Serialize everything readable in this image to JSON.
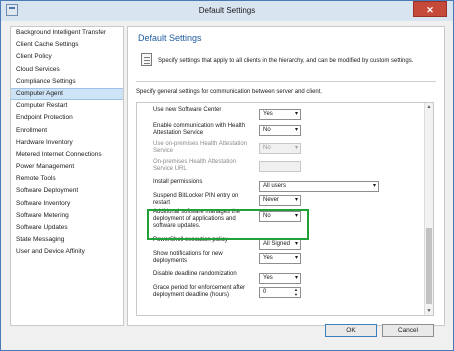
{
  "window": {
    "title": "Default Settings",
    "close_glyph": "✕"
  },
  "sidebar": {
    "items": [
      {
        "label": "Background Intelligent Transfer"
      },
      {
        "label": "Client Cache Settings"
      },
      {
        "label": "Client Policy"
      },
      {
        "label": "Cloud Services"
      },
      {
        "label": "Compliance Settings"
      },
      {
        "label": "Computer Agent",
        "selected": true
      },
      {
        "label": "Computer Restart"
      },
      {
        "label": "Endpoint Protection"
      },
      {
        "label": "Enrollment"
      },
      {
        "label": "Hardware Inventory"
      },
      {
        "label": "Metered Internet Connections"
      },
      {
        "label": "Power Management"
      },
      {
        "label": "Remote Tools"
      },
      {
        "label": "Software Deployment"
      },
      {
        "label": "Software Inventory"
      },
      {
        "label": "Software Metering"
      },
      {
        "label": "Software Updates"
      },
      {
        "label": "State Messaging"
      },
      {
        "label": "User and Device Affinity"
      }
    ]
  },
  "main": {
    "title": "Default Settings",
    "description": "Specify settings that apply to all clients in the hierarchy, and can be modified by custom settings.",
    "intro": "Specify general settings for communication between server and client."
  },
  "settings": [
    {
      "label": "Use new Software Center",
      "value": "Yes",
      "type": "select"
    },
    {
      "label": "Enable communication with Health Attestation Service",
      "value": "No",
      "type": "select"
    },
    {
      "label": "Use on-premises Health Attestation Service",
      "value": "No",
      "type": "select",
      "disabled": true
    },
    {
      "label": "On-premises Health Attestation Service URL",
      "value": "",
      "type": "text",
      "disabled": true
    },
    {
      "label": "Install permissions",
      "value": "All users",
      "type": "select"
    },
    {
      "label": "Suspend BitLocker PIN entry on restart",
      "value": "Never",
      "type": "select"
    },
    {
      "label": "Additional software manages the deployment of applications and software updates.",
      "value": "No",
      "type": "select"
    },
    {
      "label": "PowerShell execution policy",
      "value": "All Signed",
      "type": "select"
    },
    {
      "label": "Show notifications for new deployments",
      "value": "Yes",
      "type": "select"
    },
    {
      "label": "Disable deadline randomization",
      "value": "Yes",
      "type": "select"
    },
    {
      "label": "Grace period for enforcement after deployment deadline (hours)",
      "value": "0",
      "type": "spin"
    }
  ],
  "buttons": {
    "ok": "OK",
    "cancel": "Cancel"
  },
  "colors": {
    "highlight": "#20a038",
    "title_blue": "#1f5b9e",
    "close_red": "#c64a3a"
  },
  "icons": {
    "app": "window-app-icon",
    "settings_page": "document-list-icon"
  }
}
